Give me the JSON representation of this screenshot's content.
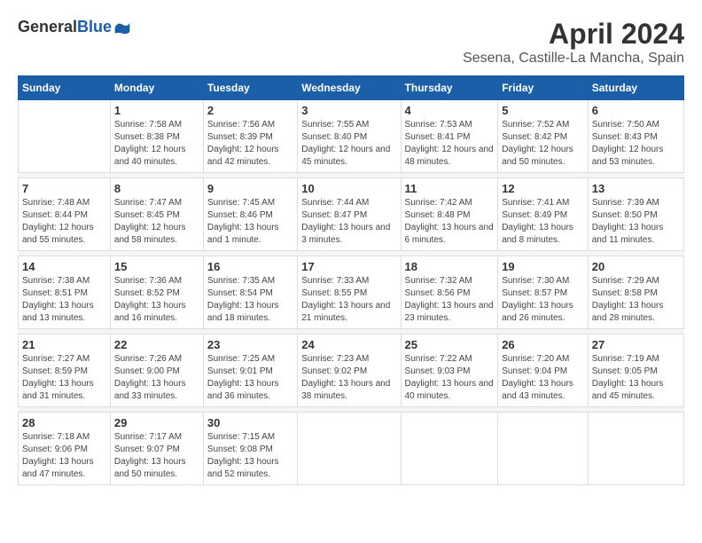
{
  "logo": {
    "general": "General",
    "blue": "Blue"
  },
  "title": "April 2024",
  "subtitle": "Sesena, Castille-La Mancha, Spain",
  "headers": [
    "Sunday",
    "Monday",
    "Tuesday",
    "Wednesday",
    "Thursday",
    "Friday",
    "Saturday"
  ],
  "weeks": [
    [
      {
        "day": "",
        "sunrise": "",
        "sunset": "",
        "daylight": ""
      },
      {
        "day": "1",
        "sunrise": "Sunrise: 7:58 AM",
        "sunset": "Sunset: 8:38 PM",
        "daylight": "Daylight: 12 hours and 40 minutes."
      },
      {
        "day": "2",
        "sunrise": "Sunrise: 7:56 AM",
        "sunset": "Sunset: 8:39 PM",
        "daylight": "Daylight: 12 hours and 42 minutes."
      },
      {
        "day": "3",
        "sunrise": "Sunrise: 7:55 AM",
        "sunset": "Sunset: 8:40 PM",
        "daylight": "Daylight: 12 hours and 45 minutes."
      },
      {
        "day": "4",
        "sunrise": "Sunrise: 7:53 AM",
        "sunset": "Sunset: 8:41 PM",
        "daylight": "Daylight: 12 hours and 48 minutes."
      },
      {
        "day": "5",
        "sunrise": "Sunrise: 7:52 AM",
        "sunset": "Sunset: 8:42 PM",
        "daylight": "Daylight: 12 hours and 50 minutes."
      },
      {
        "day": "6",
        "sunrise": "Sunrise: 7:50 AM",
        "sunset": "Sunset: 8:43 PM",
        "daylight": "Daylight: 12 hours and 53 minutes."
      }
    ],
    [
      {
        "day": "7",
        "sunrise": "Sunrise: 7:48 AM",
        "sunset": "Sunset: 8:44 PM",
        "daylight": "Daylight: 12 hours and 55 minutes."
      },
      {
        "day": "8",
        "sunrise": "Sunrise: 7:47 AM",
        "sunset": "Sunset: 8:45 PM",
        "daylight": "Daylight: 12 hours and 58 minutes."
      },
      {
        "day": "9",
        "sunrise": "Sunrise: 7:45 AM",
        "sunset": "Sunset: 8:46 PM",
        "daylight": "Daylight: 13 hours and 1 minute."
      },
      {
        "day": "10",
        "sunrise": "Sunrise: 7:44 AM",
        "sunset": "Sunset: 8:47 PM",
        "daylight": "Daylight: 13 hours and 3 minutes."
      },
      {
        "day": "11",
        "sunrise": "Sunrise: 7:42 AM",
        "sunset": "Sunset: 8:48 PM",
        "daylight": "Daylight: 13 hours and 6 minutes."
      },
      {
        "day": "12",
        "sunrise": "Sunrise: 7:41 AM",
        "sunset": "Sunset: 8:49 PM",
        "daylight": "Daylight: 13 hours and 8 minutes."
      },
      {
        "day": "13",
        "sunrise": "Sunrise: 7:39 AM",
        "sunset": "Sunset: 8:50 PM",
        "daylight": "Daylight: 13 hours and 11 minutes."
      }
    ],
    [
      {
        "day": "14",
        "sunrise": "Sunrise: 7:38 AM",
        "sunset": "Sunset: 8:51 PM",
        "daylight": "Daylight: 13 hours and 13 minutes."
      },
      {
        "day": "15",
        "sunrise": "Sunrise: 7:36 AM",
        "sunset": "Sunset: 8:52 PM",
        "daylight": "Daylight: 13 hours and 16 minutes."
      },
      {
        "day": "16",
        "sunrise": "Sunrise: 7:35 AM",
        "sunset": "Sunset: 8:54 PM",
        "daylight": "Daylight: 13 hours and 18 minutes."
      },
      {
        "day": "17",
        "sunrise": "Sunrise: 7:33 AM",
        "sunset": "Sunset: 8:55 PM",
        "daylight": "Daylight: 13 hours and 21 minutes."
      },
      {
        "day": "18",
        "sunrise": "Sunrise: 7:32 AM",
        "sunset": "Sunset: 8:56 PM",
        "daylight": "Daylight: 13 hours and 23 minutes."
      },
      {
        "day": "19",
        "sunrise": "Sunrise: 7:30 AM",
        "sunset": "Sunset: 8:57 PM",
        "daylight": "Daylight: 13 hours and 26 minutes."
      },
      {
        "day": "20",
        "sunrise": "Sunrise: 7:29 AM",
        "sunset": "Sunset: 8:58 PM",
        "daylight": "Daylight: 13 hours and 28 minutes."
      }
    ],
    [
      {
        "day": "21",
        "sunrise": "Sunrise: 7:27 AM",
        "sunset": "Sunset: 8:59 PM",
        "daylight": "Daylight: 13 hours and 31 minutes."
      },
      {
        "day": "22",
        "sunrise": "Sunrise: 7:26 AM",
        "sunset": "Sunset: 9:00 PM",
        "daylight": "Daylight: 13 hours and 33 minutes."
      },
      {
        "day": "23",
        "sunrise": "Sunrise: 7:25 AM",
        "sunset": "Sunset: 9:01 PM",
        "daylight": "Daylight: 13 hours and 36 minutes."
      },
      {
        "day": "24",
        "sunrise": "Sunrise: 7:23 AM",
        "sunset": "Sunset: 9:02 PM",
        "daylight": "Daylight: 13 hours and 38 minutes."
      },
      {
        "day": "25",
        "sunrise": "Sunrise: 7:22 AM",
        "sunset": "Sunset: 9:03 PM",
        "daylight": "Daylight: 13 hours and 40 minutes."
      },
      {
        "day": "26",
        "sunrise": "Sunrise: 7:20 AM",
        "sunset": "Sunset: 9:04 PM",
        "daylight": "Daylight: 13 hours and 43 minutes."
      },
      {
        "day": "27",
        "sunrise": "Sunrise: 7:19 AM",
        "sunset": "Sunset: 9:05 PM",
        "daylight": "Daylight: 13 hours and 45 minutes."
      }
    ],
    [
      {
        "day": "28",
        "sunrise": "Sunrise: 7:18 AM",
        "sunset": "Sunset: 9:06 PM",
        "daylight": "Daylight: 13 hours and 47 minutes."
      },
      {
        "day": "29",
        "sunrise": "Sunrise: 7:17 AM",
        "sunset": "Sunset: 9:07 PM",
        "daylight": "Daylight: 13 hours and 50 minutes."
      },
      {
        "day": "30",
        "sunrise": "Sunrise: 7:15 AM",
        "sunset": "Sunset: 9:08 PM",
        "daylight": "Daylight: 13 hours and 52 minutes."
      },
      {
        "day": "",
        "sunrise": "",
        "sunset": "",
        "daylight": ""
      },
      {
        "day": "",
        "sunrise": "",
        "sunset": "",
        "daylight": ""
      },
      {
        "day": "",
        "sunrise": "",
        "sunset": "",
        "daylight": ""
      },
      {
        "day": "",
        "sunrise": "",
        "sunset": "",
        "daylight": ""
      }
    ]
  ]
}
